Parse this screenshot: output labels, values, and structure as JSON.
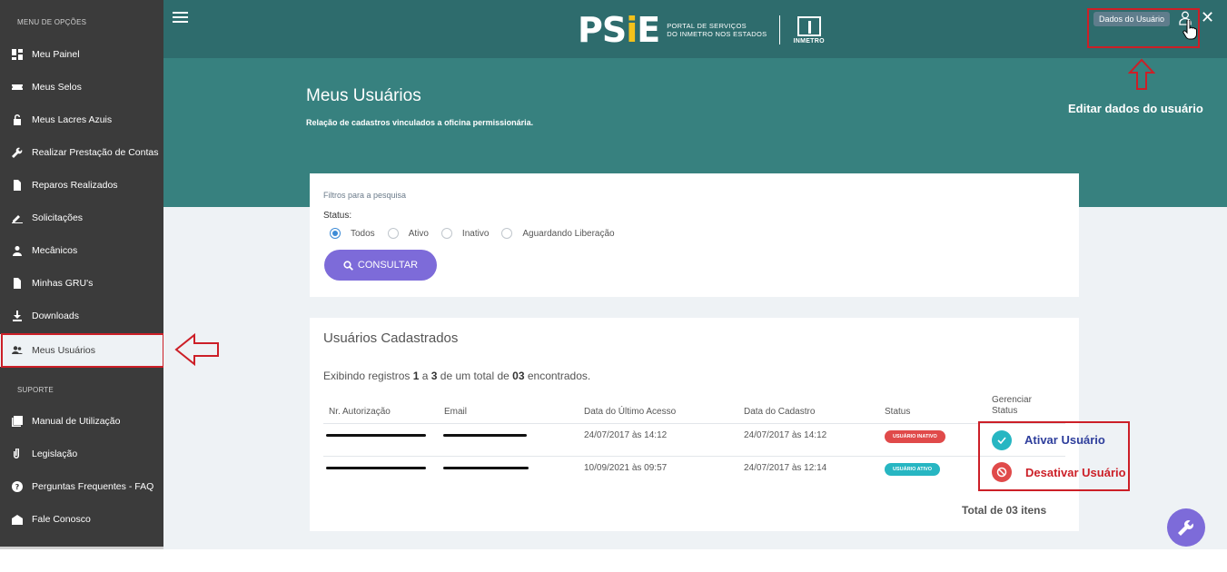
{
  "sidebar": {
    "menu_section": "MENU DE OPÇÕES",
    "support_section": "SUPORTE",
    "items": [
      {
        "label": "Meu Painel",
        "icon": "dashboard-icon"
      },
      {
        "label": "Meus Selos",
        "icon": "ticket-icon"
      },
      {
        "label": "Meus Lacres Azuis",
        "icon": "unlock-icon"
      },
      {
        "label": "Realizar Prestação de Contas",
        "icon": "wrench-icon"
      },
      {
        "label": "Reparos Realizados",
        "icon": "document-icon"
      },
      {
        "label": "Solicitações",
        "icon": "pencil-icon"
      },
      {
        "label": "Mecânicos",
        "icon": "person-icon"
      },
      {
        "label": "Minhas GRU's",
        "icon": "file-icon"
      },
      {
        "label": "Downloads",
        "icon": "download-icon"
      },
      {
        "label": "Meus Usuários",
        "icon": "users-icon",
        "active": true
      }
    ],
    "support_items": [
      {
        "label": "Manual de Utilização",
        "icon": "manual-icon"
      },
      {
        "label": "Legislação",
        "icon": "paperclip-icon"
      },
      {
        "label": "Perguntas Frequentes - FAQ",
        "icon": "help-icon"
      },
      {
        "label": "Fale Conosco",
        "icon": "mail-icon"
      }
    ]
  },
  "header": {
    "logo_psie": "PSiE",
    "logo_line1": "PORTAL DE SERVIÇOS",
    "logo_line2": "DO INMETRO NOS ESTADOS",
    "logo_inmetro": "INMETRO",
    "user_tooltip": "Dados do Usuário"
  },
  "annotations": {
    "edit_user": "Editar dados do usuário",
    "activate_user": "Ativar Usuário",
    "deactivate_user": "Desativar Usuário"
  },
  "page": {
    "title": "Meus Usuários",
    "subtitle": "Relação de cadastros vinculados a oficina permissionária."
  },
  "filters": {
    "caption": "Filtros para a pesquisa",
    "status_label": "Status:",
    "options": [
      "Todos",
      "Ativo",
      "Inativo",
      "Aguardando Liberação"
    ],
    "selected": "Todos",
    "button": "CONSULTAR"
  },
  "users": {
    "title": "Usuários Cadastrados",
    "summary": {
      "prefix": "Exibindo registros ",
      "from": "1",
      "mid1": " a ",
      "to": "3",
      "mid2": " de um total de ",
      "total": "03",
      "suffix": " encontrados."
    },
    "columns": [
      "Nr. Autorização",
      "Email",
      "Data do Último Acesso",
      "Data do Cadastro",
      "Status",
      "Gerenciar Status"
    ],
    "rows": [
      {
        "last_access": "24/07/2017 às 14:12",
        "created": "24/07/2017 às 14:12",
        "status": "USUÁRIO INATIVO"
      },
      {
        "last_access": "10/09/2021 às 09:57",
        "created": "24/07/2017 às 12:14",
        "status": "USUÁRIO ATIVO"
      }
    ],
    "total_label": "Total de 03 itens"
  },
  "colors": {
    "sidebar": "#3b3b3b",
    "topbar": "#2e6c6d",
    "hero": "#37817f",
    "accent": "#7d6bd9",
    "annotation_red": "#cc1f27"
  }
}
